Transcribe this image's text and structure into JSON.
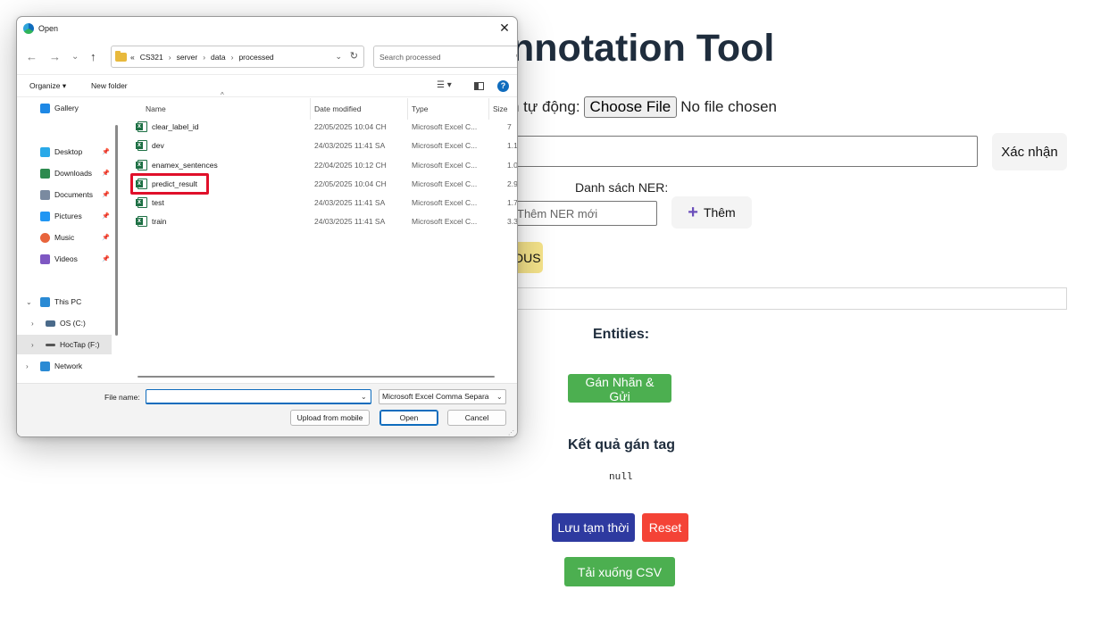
{
  "app": {
    "title": "nnotation Tool",
    "file_prompt": "n tự động:",
    "choose_file_label": "Choose File",
    "no_file_text": "No file chosen",
    "confirm_label": "Xác nhận",
    "ner_list_label": "Danh sách NER:",
    "ner_input_placeholder": "Thêm NER mới",
    "add_label": "Thêm",
    "tag_chip_text": "DUS",
    "entities_title": "Entities:",
    "assign_label": "Gán Nhãn & Gửi",
    "result_title": "Kết quả gán tag",
    "result_value": "null",
    "save_temp_label": "Lưu tạm thời",
    "reset_label": "Reset",
    "download_label": "Tải xuống CSV"
  },
  "dialog": {
    "title": "Open",
    "close_glyph": "✕",
    "nav": {
      "back": "←",
      "forward": "→",
      "recent": "⌄",
      "up": "↑"
    },
    "breadcrumb": [
      "«",
      "CS321",
      "server",
      "data",
      "processed"
    ],
    "search_placeholder": "Search processed",
    "toolbar": {
      "organize": "Organize ▾",
      "new_folder": "New folder",
      "view_glyph": "☰ ▾",
      "help_glyph": "?"
    },
    "sidebar": [
      {
        "label": "Gallery",
        "icon": "gallery-icon",
        "color": "#1e88e5",
        "pinned": false
      },
      {
        "label": "Desktop",
        "icon": "desktop-icon",
        "color": "#29a9e8",
        "pinned": true
      },
      {
        "label": "Downloads",
        "icon": "downloads-icon",
        "color": "#2c8a4e",
        "pinned": true
      },
      {
        "label": "Documents",
        "icon": "documents-icon",
        "color": "#7a8aa0",
        "pinned": true
      },
      {
        "label": "Pictures",
        "icon": "pictures-icon",
        "color": "#2196f3",
        "pinned": true
      },
      {
        "label": "Music",
        "icon": "music-icon",
        "color": "#e8643c",
        "pinned": true
      },
      {
        "label": "Videos",
        "icon": "videos-icon",
        "color": "#7e57c2",
        "pinned": true
      },
      {
        "label": "This PC",
        "icon": "this-pc-icon",
        "color": "#2a8ad4",
        "pinned": false
      },
      {
        "label": "OS (C:)",
        "icon": "drive-c-icon",
        "color": "#4a6a8a",
        "pinned": false
      },
      {
        "label": "HocTap (F:)",
        "icon": "drive-f-icon",
        "color": "#555555",
        "pinned": false
      },
      {
        "label": "Network",
        "icon": "network-icon",
        "color": "#2a8ad4",
        "pinned": false
      }
    ],
    "columns": [
      "Name",
      "Date modified",
      "Type",
      "Size"
    ],
    "files": [
      {
        "name": "clear_label_id",
        "date": "22/05/2025 10:04 CH",
        "type": "Microsoft Excel C...",
        "size": "7"
      },
      {
        "name": "dev",
        "date": "24/03/2025 11:41 SA",
        "type": "Microsoft Excel C...",
        "size": "1.1"
      },
      {
        "name": "enamex_sentences",
        "date": "22/04/2025 10:12 CH",
        "type": "Microsoft Excel C...",
        "size": "1.0"
      },
      {
        "name": "predict_result",
        "date": "22/05/2025 10:04 CH",
        "type": "Microsoft Excel C...",
        "size": "2.9"
      },
      {
        "name": "test",
        "date": "24/03/2025 11:41 SA",
        "type": "Microsoft Excel C...",
        "size": "1.7"
      },
      {
        "name": "train",
        "date": "24/03/2025 11:41 SA",
        "type": "Microsoft Excel C...",
        "size": "3.3"
      }
    ],
    "file_name_label": "File name:",
    "file_name_value": "",
    "file_type_value": "Microsoft Excel Comma Separa",
    "upload_label": "Upload from mobile",
    "open_label": "Open",
    "cancel_label": "Cancel"
  }
}
